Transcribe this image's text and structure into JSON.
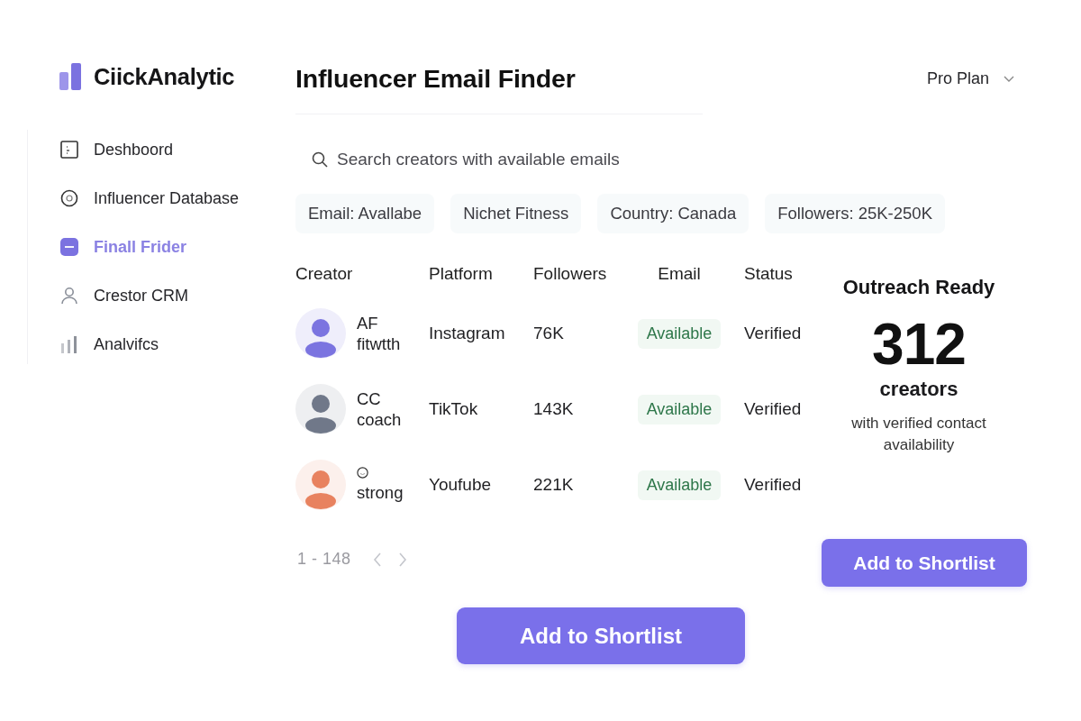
{
  "app": {
    "logo": "CiickAnalytic"
  },
  "sidebar": {
    "items": [
      {
        "label": "Deshboord",
        "selected": false
      },
      {
        "label": "Influencer Database",
        "selected": false
      },
      {
        "label": "Finall Frider",
        "selected": true
      },
      {
        "label": "Crestor CRM",
        "selected": false
      },
      {
        "label": "Analvifcs",
        "selected": false
      }
    ]
  },
  "header": {
    "title": "Influencer Email Finder",
    "plan": "Pro Plan"
  },
  "search": {
    "placeholder": "Search creators with available emails"
  },
  "filters": [
    "Email: Avallabe",
    "Nichet Fitness",
    "Country: Canada",
    "Followers: 25K-250K"
  ],
  "table": {
    "columns": [
      "Creator",
      "Platform",
      "Followers",
      "Email",
      "Status"
    ],
    "rows": [
      {
        "name": "AF fitwtth",
        "emoji": false,
        "color": "#7b74e0",
        "platform": "Instagram",
        "followers": "76K",
        "email": "Available",
        "status": "Verified"
      },
      {
        "name": "CC coach",
        "emoji": false,
        "color": "#707889",
        "platform": "TikTok",
        "followers": "143K",
        "email": "Available",
        "status": "Verified"
      },
      {
        "name": "strong",
        "emoji": true,
        "color": "#e8825f",
        "platform": "Youfube",
        "followers": "221K",
        "email": "Available",
        "status": "Verified"
      }
    ]
  },
  "summary": {
    "title": "Outreach Ready",
    "count": "312",
    "unit": "creators",
    "note": "with verified contact availability"
  },
  "pagination": {
    "range": "1 - 148"
  },
  "buttons": [
    "Add to Shortlist",
    "Add to Shortlist"
  ]
}
